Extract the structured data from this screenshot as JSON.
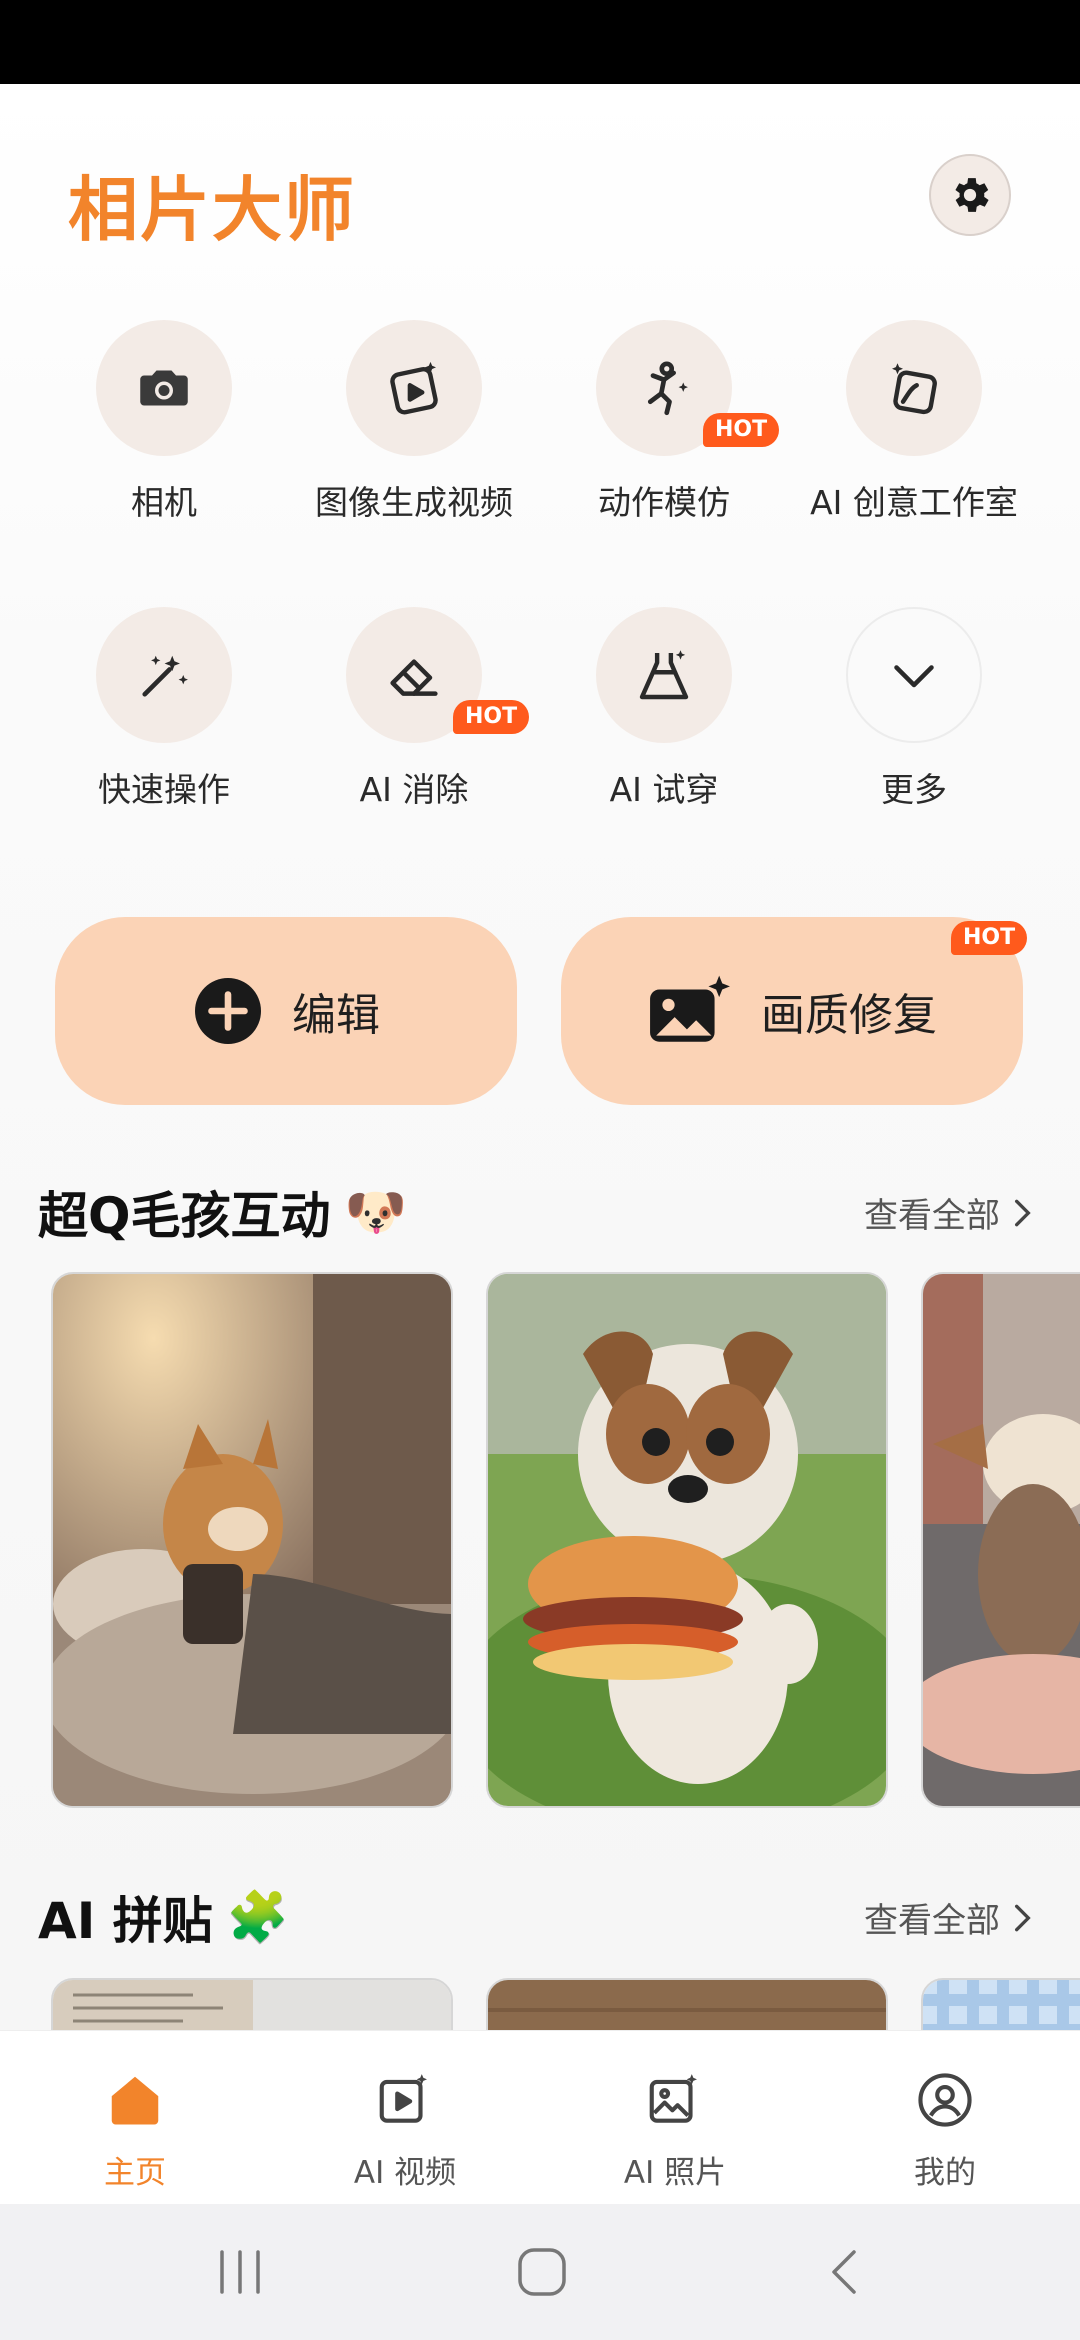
{
  "app": {
    "title": "相片大师"
  },
  "tools": [
    {
      "label": "相机",
      "icon": "camera-icon"
    },
    {
      "label": "图像生成视频",
      "icon": "image-to-video-icon"
    },
    {
      "label": "动作模仿",
      "icon": "dance-motion-icon",
      "badge": "HOT"
    },
    {
      "label": "AI 创意工作室",
      "icon": "creative-studio-icon"
    },
    {
      "label": "快速操作",
      "icon": "magic-wand-icon"
    },
    {
      "label": "AI 消除",
      "icon": "eraser-icon",
      "badge": "HOT"
    },
    {
      "label": "AI 试穿",
      "icon": "dress-icon"
    },
    {
      "label": "更多",
      "icon": "chevron-down-icon"
    }
  ],
  "actions": {
    "edit": {
      "label": "编辑"
    },
    "enhance": {
      "label": "画质修复",
      "badge": "HOT"
    }
  },
  "sections": {
    "pets": {
      "title": "超Q毛孩互动",
      "emoji": "🐶",
      "view_all": "查看全部"
    },
    "collage": {
      "title": "AI 拼贴",
      "emoji": "🧩",
      "view_all": "查看全部"
    }
  },
  "bottom_nav": [
    {
      "label": "主页",
      "icon": "home-icon",
      "active": true
    },
    {
      "label": "AI 视频",
      "icon": "ai-video-icon"
    },
    {
      "label": "AI 照片",
      "icon": "ai-photo-icon"
    },
    {
      "label": "我的",
      "icon": "profile-icon"
    }
  ],
  "colors": {
    "accent": "#f2842b",
    "hot": "#ff5a1c",
    "button_bg": "#fbd3b6"
  }
}
